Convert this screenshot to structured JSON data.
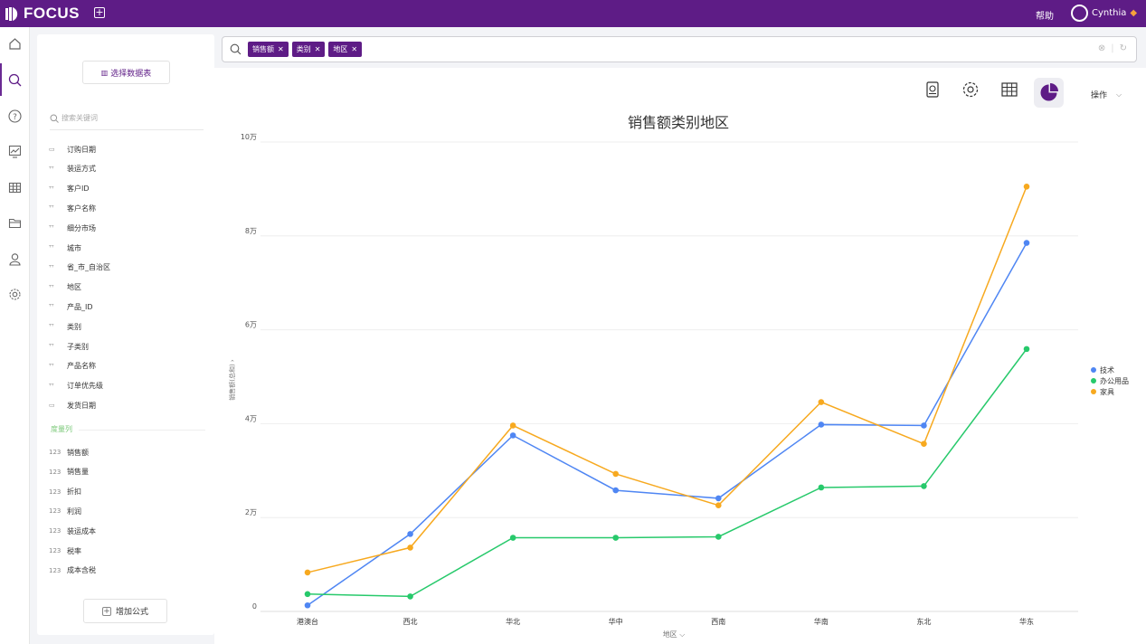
{
  "app": {
    "logo_text": "FOCUS",
    "help_label": "帮助",
    "user_name": "Cynthia"
  },
  "panel": {
    "select_table_label": "选择数据表",
    "search_placeholder": "搜索关键词",
    "dimension_fields": [
      {
        "type": "date",
        "label": "订购日期"
      },
      {
        "type": "text",
        "label": "装运方式"
      },
      {
        "type": "text",
        "label": "客户ID"
      },
      {
        "type": "text",
        "label": "客户名称"
      },
      {
        "type": "text",
        "label": "细分市场"
      },
      {
        "type": "text",
        "label": "城市"
      },
      {
        "type": "text",
        "label": "省_市_自治区"
      },
      {
        "type": "text",
        "label": "地区"
      },
      {
        "type": "text",
        "label": "产品_ID"
      },
      {
        "type": "text",
        "label": "类别"
      },
      {
        "type": "text",
        "label": "子类别"
      },
      {
        "type": "text",
        "label": "产品名称"
      },
      {
        "type": "text",
        "label": "订单优先级"
      },
      {
        "type": "date",
        "label": "发货日期"
      }
    ],
    "measure_section_label": "度量列",
    "measure_fields": [
      {
        "type": "123",
        "label": "销售额"
      },
      {
        "type": "123",
        "label": "销售量"
      },
      {
        "type": "123",
        "label": "折扣"
      },
      {
        "type": "123",
        "label": "利润"
      },
      {
        "type": "123",
        "label": "装运成本"
      },
      {
        "type": "123",
        "label": "税率"
      },
      {
        "type": "123",
        "label": "成本含税"
      }
    ],
    "add_formula_label": "增加公式"
  },
  "search": {
    "tokens": [
      "销售额",
      "类别",
      "地区"
    ]
  },
  "toolbar": {
    "ops_label": "操作"
  },
  "chart_data": {
    "type": "line",
    "title": "销售额类别地区",
    "xlabel": "地区",
    "ylabel": "销售额(总和)",
    "categories": [
      "港澳台",
      "西北",
      "华北",
      "华中",
      "西南",
      "华南",
      "东北",
      "华东"
    ],
    "yticks": [
      "0",
      "2万",
      "4万",
      "6万",
      "8万",
      "10万"
    ],
    "ylim": [
      0,
      100000
    ],
    "series": [
      {
        "name": "技术",
        "color": "#4f86f3",
        "values": [
          1300,
          16500,
          37500,
          25800,
          24100,
          39800,
          39600,
          78500
        ]
      },
      {
        "name": "办公用品",
        "color": "#27c96b",
        "values": [
          3700,
          3200,
          15700,
          15700,
          15900,
          26400,
          26700,
          55900
        ]
      },
      {
        "name": "家具",
        "color": "#f7a91f",
        "values": [
          8300,
          13600,
          39600,
          29300,
          22600,
          44600,
          35700,
          90500
        ]
      }
    ],
    "grid": true,
    "legend": "right"
  }
}
